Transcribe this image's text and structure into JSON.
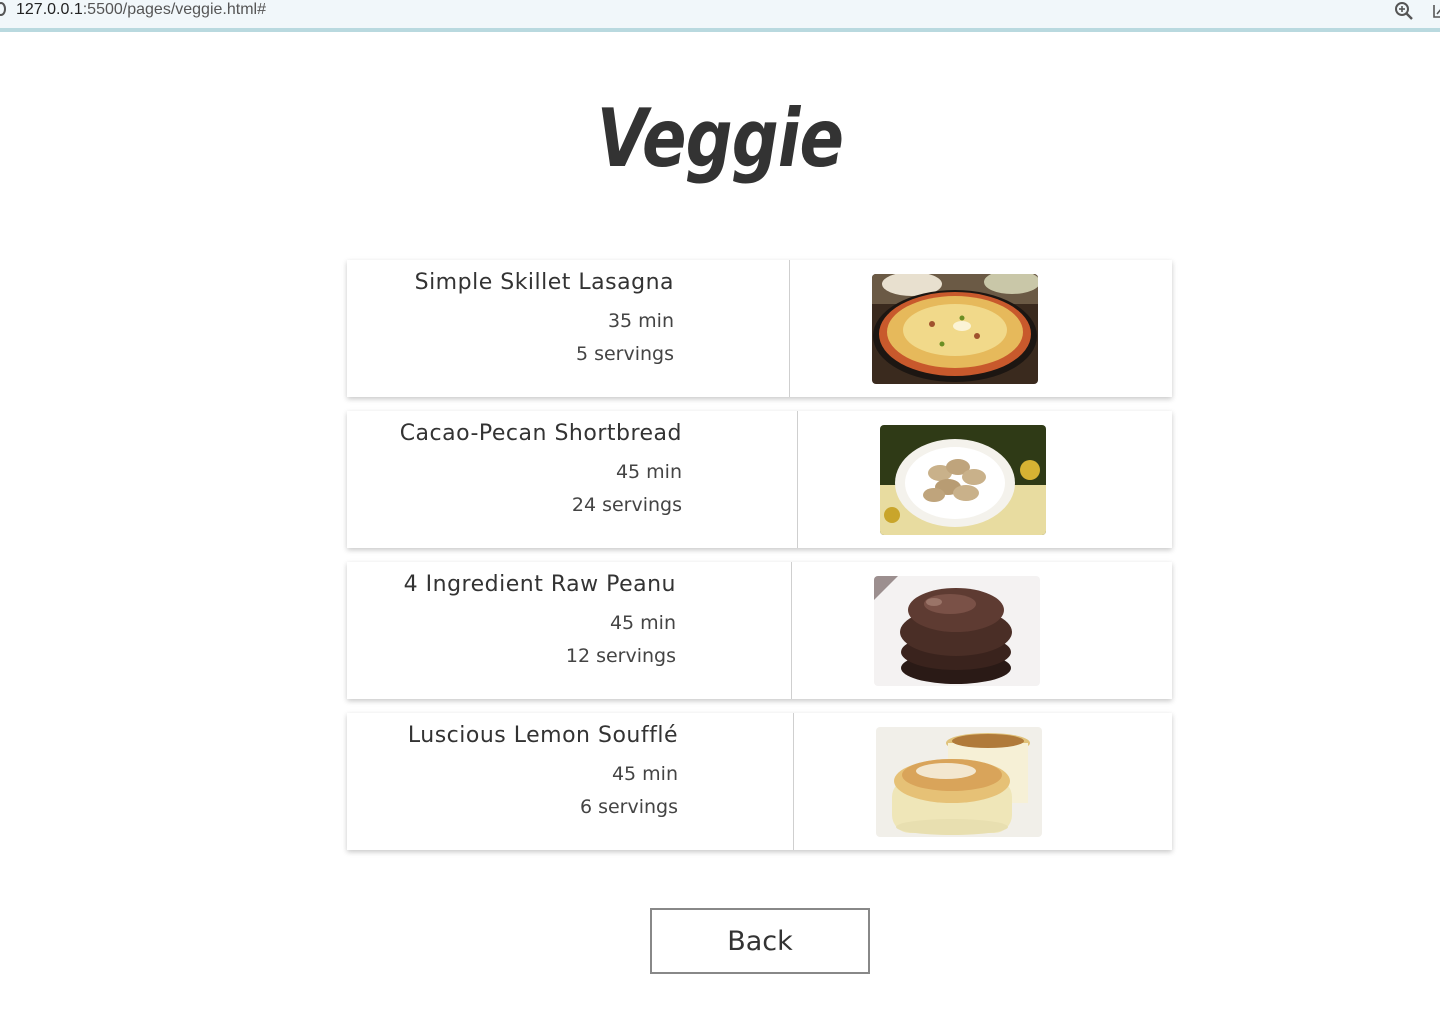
{
  "browser": {
    "url_host": "127.0.0.1",
    "url_path": ":5500/pages/veggie.html#"
  },
  "page": {
    "title": "Veggie"
  },
  "recipes": [
    {
      "name": "Simple Skillet Lasagna",
      "time": "35 min",
      "servings": "5 servings",
      "image": "skillet-lasagna-photo"
    },
    {
      "name": "Cacao-Pecan Shortbread",
      "time": "45 min",
      "servings": "24 servings",
      "image": "shortbread-cookies-photo"
    },
    {
      "name": "4 Ingredient Raw Peanu",
      "time": "45 min",
      "servings": "12 servings",
      "image": "chocolate-peanut-cups-photo"
    },
    {
      "name": "Luscious Lemon Soufflé",
      "time": "45 min",
      "servings": "6 servings",
      "image": "lemon-souffle-photo"
    }
  ],
  "back_button": {
    "label": "Back"
  }
}
